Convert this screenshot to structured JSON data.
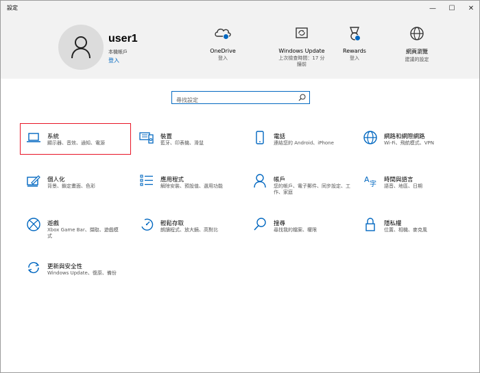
{
  "window": {
    "title": "設定",
    "minimize_glyph": "—",
    "maximize_glyph": "☐",
    "close_glyph": "✕"
  },
  "header": {
    "user": {
      "name": "user1",
      "account_type": "本機帳戶",
      "sign_in_link": "登入",
      "avatar_icon": "person-icon"
    },
    "quick_links": [
      {
        "label": "OneDrive",
        "sub": "登入",
        "icon": "onedrive-cloud-icon"
      },
      {
        "label": "Windows Update",
        "sub": "上次檢查時間：17 分鐘前",
        "icon": "windows-update-icon"
      },
      {
        "label": "Rewards",
        "sub": "登入",
        "icon": "rewards-medal-icon"
      },
      {
        "label": "網頁瀏覽",
        "sub": "建議的設定",
        "icon": "globe-icon"
      }
    ]
  },
  "search": {
    "placeholder": "尋找設定",
    "icon": "search-icon"
  },
  "categories": [
    {
      "id": "system",
      "label": "系統",
      "desc": "顯示器、音效、通知、電源",
      "icon": "laptop-icon"
    },
    {
      "id": "devices",
      "label": "裝置",
      "desc": "藍牙、印表機、滑鼠",
      "icon": "devices-icon"
    },
    {
      "id": "phone",
      "label": "電話",
      "desc": "連結您的 Android、iPhone",
      "icon": "phone-icon"
    },
    {
      "id": "network",
      "label": "網路和網際網路",
      "desc": "Wi-Fi、飛航模式、VPN",
      "icon": "globe-icon"
    },
    {
      "id": "personalization",
      "label": "個人化",
      "desc": "背景、鎖定畫面、色彩",
      "icon": "personalization-icon"
    },
    {
      "id": "apps",
      "label": "應用程式",
      "desc": "解除安裝、預設值、選用功能",
      "icon": "apps-list-icon"
    },
    {
      "id": "accounts",
      "label": "帳戶",
      "desc": "您的帳戶、電子郵件、同步設定、工作、家庭",
      "icon": "person-icon"
    },
    {
      "id": "time-language",
      "label": "時間與語言",
      "desc": "語音、地區、日期",
      "icon": "time-language-icon"
    },
    {
      "id": "gaming",
      "label": "遊戲",
      "desc": "Xbox Game Bar、擷取、遊戲模式",
      "icon": "xbox-icon"
    },
    {
      "id": "ease-of-access",
      "label": "輕鬆存取",
      "desc": "朗讀程式、放大鏡、高對比",
      "icon": "ease-of-access-icon"
    },
    {
      "id": "search",
      "label": "搜尋",
      "desc": "尋找我的檔案、權限",
      "icon": "search-icon"
    },
    {
      "id": "privacy",
      "label": "隱私權",
      "desc": "位置、相機、麥克風",
      "icon": "lock-icon"
    },
    {
      "id": "update-security",
      "label": "更新與安全性",
      "desc": "Windows Update、復原、備份",
      "icon": "sync-icon"
    }
  ],
  "colors": {
    "accent": "#0067c0",
    "header_bg": "#f2f2f2",
    "selection_outline": "#e81123"
  }
}
